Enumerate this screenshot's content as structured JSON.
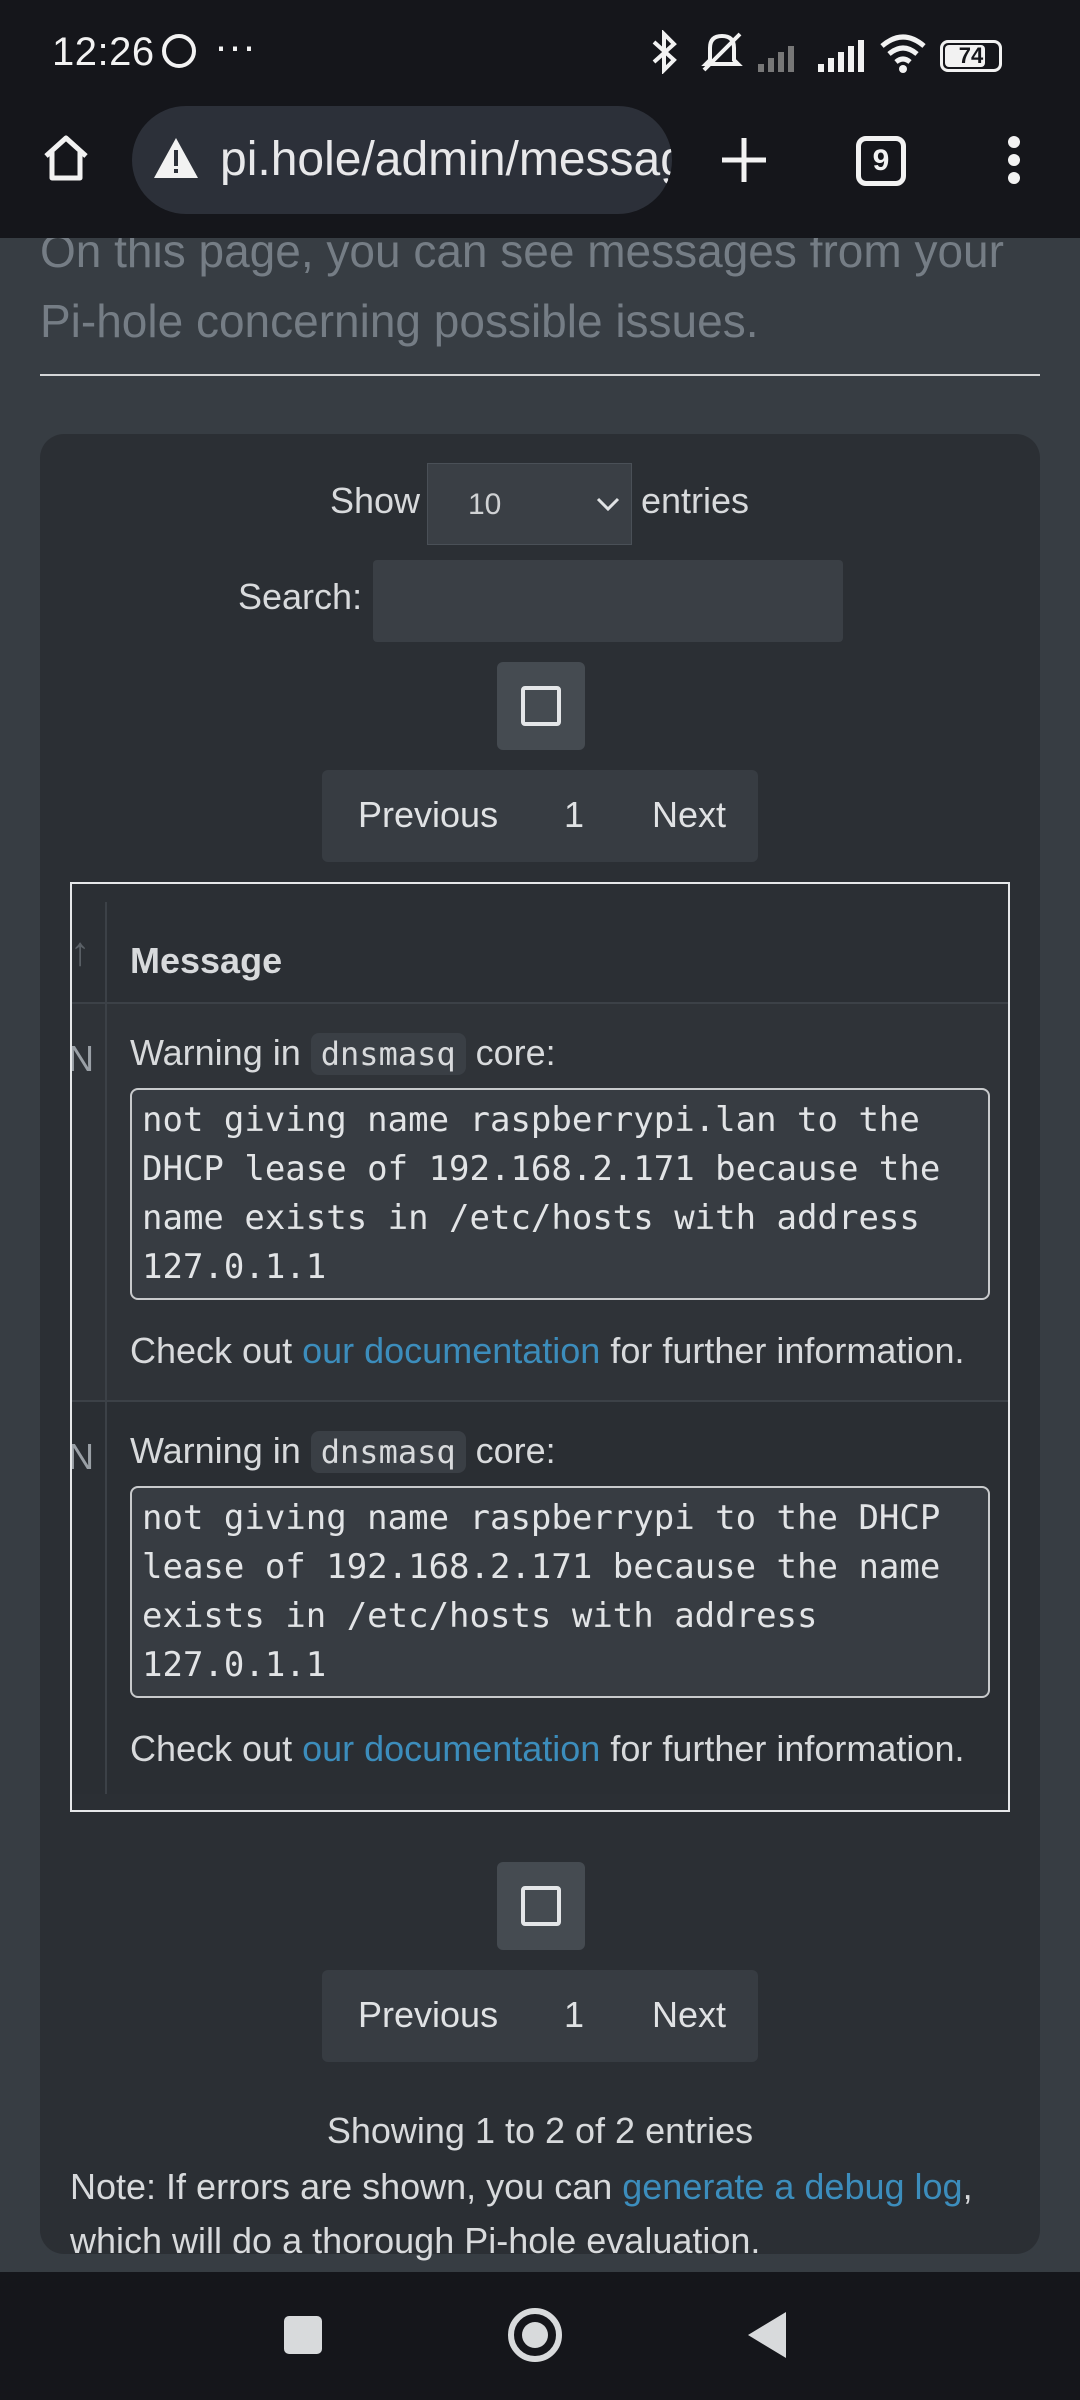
{
  "status": {
    "time": "12:26",
    "battery": "74"
  },
  "browser": {
    "url": "pi.hole/admin/messages.php",
    "tab_count": "9"
  },
  "page": {
    "intro": "On this page, you can see messages from your Pi-hole concerning possible issues.",
    "show_label": "Show",
    "entries_value": "10",
    "entries_label": "entries",
    "search_label": "Search:",
    "pager": {
      "previous": "Previous",
      "page": "1",
      "next": "Next"
    },
    "table": {
      "header": "Message",
      "rows": [
        {
          "prefix": "Warning in",
          "code": "dnsmasq",
          "suffix": "core:",
          "detail": "not giving name raspberrypi.lan to the\nDHCP lease of 192.168.2.171 because the\nname exists in /etc/hosts with address\n127.0.1.1",
          "check_prefix": "Check out",
          "link": "our documentation",
          "check_suffix": "for further information."
        },
        {
          "prefix": "Warning in",
          "code": "dnsmasq",
          "suffix": "core:",
          "detail": "not giving name raspberrypi to the DHCP\nlease of 192.168.2.171 because the name\nexists in /etc/hosts with address\n127.0.1.1",
          "check_prefix": "Check out",
          "link": "our documentation",
          "check_suffix": "for further information."
        }
      ]
    },
    "info": "Showing 1 to 2 of 2 entries",
    "note_prefix": "Note: If errors are shown, you can",
    "note_link": "generate a debug log",
    "note_line2": "which will do a thorough Pi-hole evaluation."
  },
  "icons": [
    "whatsapp-icon",
    "more-dots-icon",
    "bluetooth-icon",
    "silent-icon",
    "signal-icon",
    "wifi-icon",
    "battery-icon",
    "home-icon",
    "warning-icon",
    "new-tab-icon",
    "tabs-icon",
    "menu-icon",
    "checkbox-icon",
    "nav-recents-icon",
    "nav-home-icon",
    "nav-back-icon"
  ]
}
